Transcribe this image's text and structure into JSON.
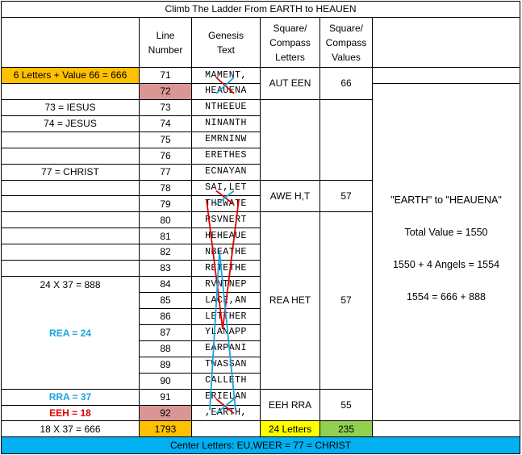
{
  "title": "Climb The Ladder From EARTH to HEAUEN",
  "headers": {
    "line_number": [
      "Line",
      "Number"
    ],
    "genesis_text": [
      "Genesis",
      "Text"
    ],
    "letters": [
      "Square/",
      "Compass",
      "Letters"
    ],
    "values": [
      "Square/",
      "Compass",
      "Values"
    ]
  },
  "rows": [
    {
      "note": "6 Letters + Value 66 = 666",
      "line": "71",
      "text": "MAMENT,"
    },
    {
      "note": "",
      "line": "72",
      "text": "HEAUENA"
    },
    {
      "note": "73 = IESUS",
      "line": "73",
      "text": "NTHEEUE"
    },
    {
      "note": "74 = JESUS",
      "line": "74",
      "text": "NINANTH"
    },
    {
      "note": "",
      "line": "75",
      "text": "EMRNINW"
    },
    {
      "note": "",
      "line": "76",
      "text": "ERETHES"
    },
    {
      "note": "77 = CHRIST",
      "line": "77",
      "text": "ECNAYAN"
    },
    {
      "note": "",
      "line": "78",
      "text": "SAI,LET"
    },
    {
      "note": "",
      "line": "79",
      "text": "THEWATE"
    },
    {
      "note": "",
      "line": "80",
      "text": "RSVNERT"
    },
    {
      "note": "",
      "line": "81",
      "text": "HEHEAUE"
    },
    {
      "note": "",
      "line": "82",
      "text": "NBEATHE"
    },
    {
      "note": "",
      "line": "83",
      "text": "RETETHE"
    },
    {
      "note": "24 X 37 = 888",
      "line": "84",
      "text": "RVNTNEP"
    },
    {
      "note": "",
      "line": "85",
      "text": "LACE,AN"
    },
    {
      "note": "",
      "line": "86",
      "text": "LETTHER"
    },
    {
      "note": "",
      "line": "87",
      "text": "YLANAPP"
    },
    {
      "note": "",
      "line": "88",
      "text": "EARPANI"
    },
    {
      "note": "",
      "line": "89",
      "text": "TWASSAN"
    },
    {
      "note": "",
      "line": "90",
      "text": "CALLETH"
    },
    {
      "note": "RRA = 37",
      "line": "91",
      "text": "ERIELAN"
    },
    {
      "note": "EEH = 18",
      "line": "92",
      "text": ",EARTH,"
    }
  ],
  "rea_note": "REA = 24",
  "groups": [
    {
      "letters": "AUT EEN",
      "value": "66"
    },
    {
      "letters": "AWE H,T",
      "value": "57"
    },
    {
      "letters": "REA HET",
      "value": "57"
    },
    {
      "letters": "EEH RRA",
      "value": "55"
    }
  ],
  "summary": {
    "line1": "\"EARTH\" to \"HEAUENA\"",
    "line2": "Total Value = 1550",
    "line3": "1550 + 4 Angels = 1554",
    "line4": "1554 = 666 + 888"
  },
  "totals": {
    "note": "18 X 37 = 666",
    "line_total": "1793",
    "letters_total": "24 Letters",
    "value_total": "235"
  },
  "footer": "Center Letters:  EU,WEER = 77 = CHRIST",
  "colors": {
    "orange": "#ffc000",
    "pink": "#da9694",
    "yellow": "#ffff00",
    "green": "#92d050",
    "blue_bar": "#00b0f0",
    "blue_text": "#1aa3e0",
    "red_line": "#e00000",
    "blue_line": "#1aa3e0"
  }
}
